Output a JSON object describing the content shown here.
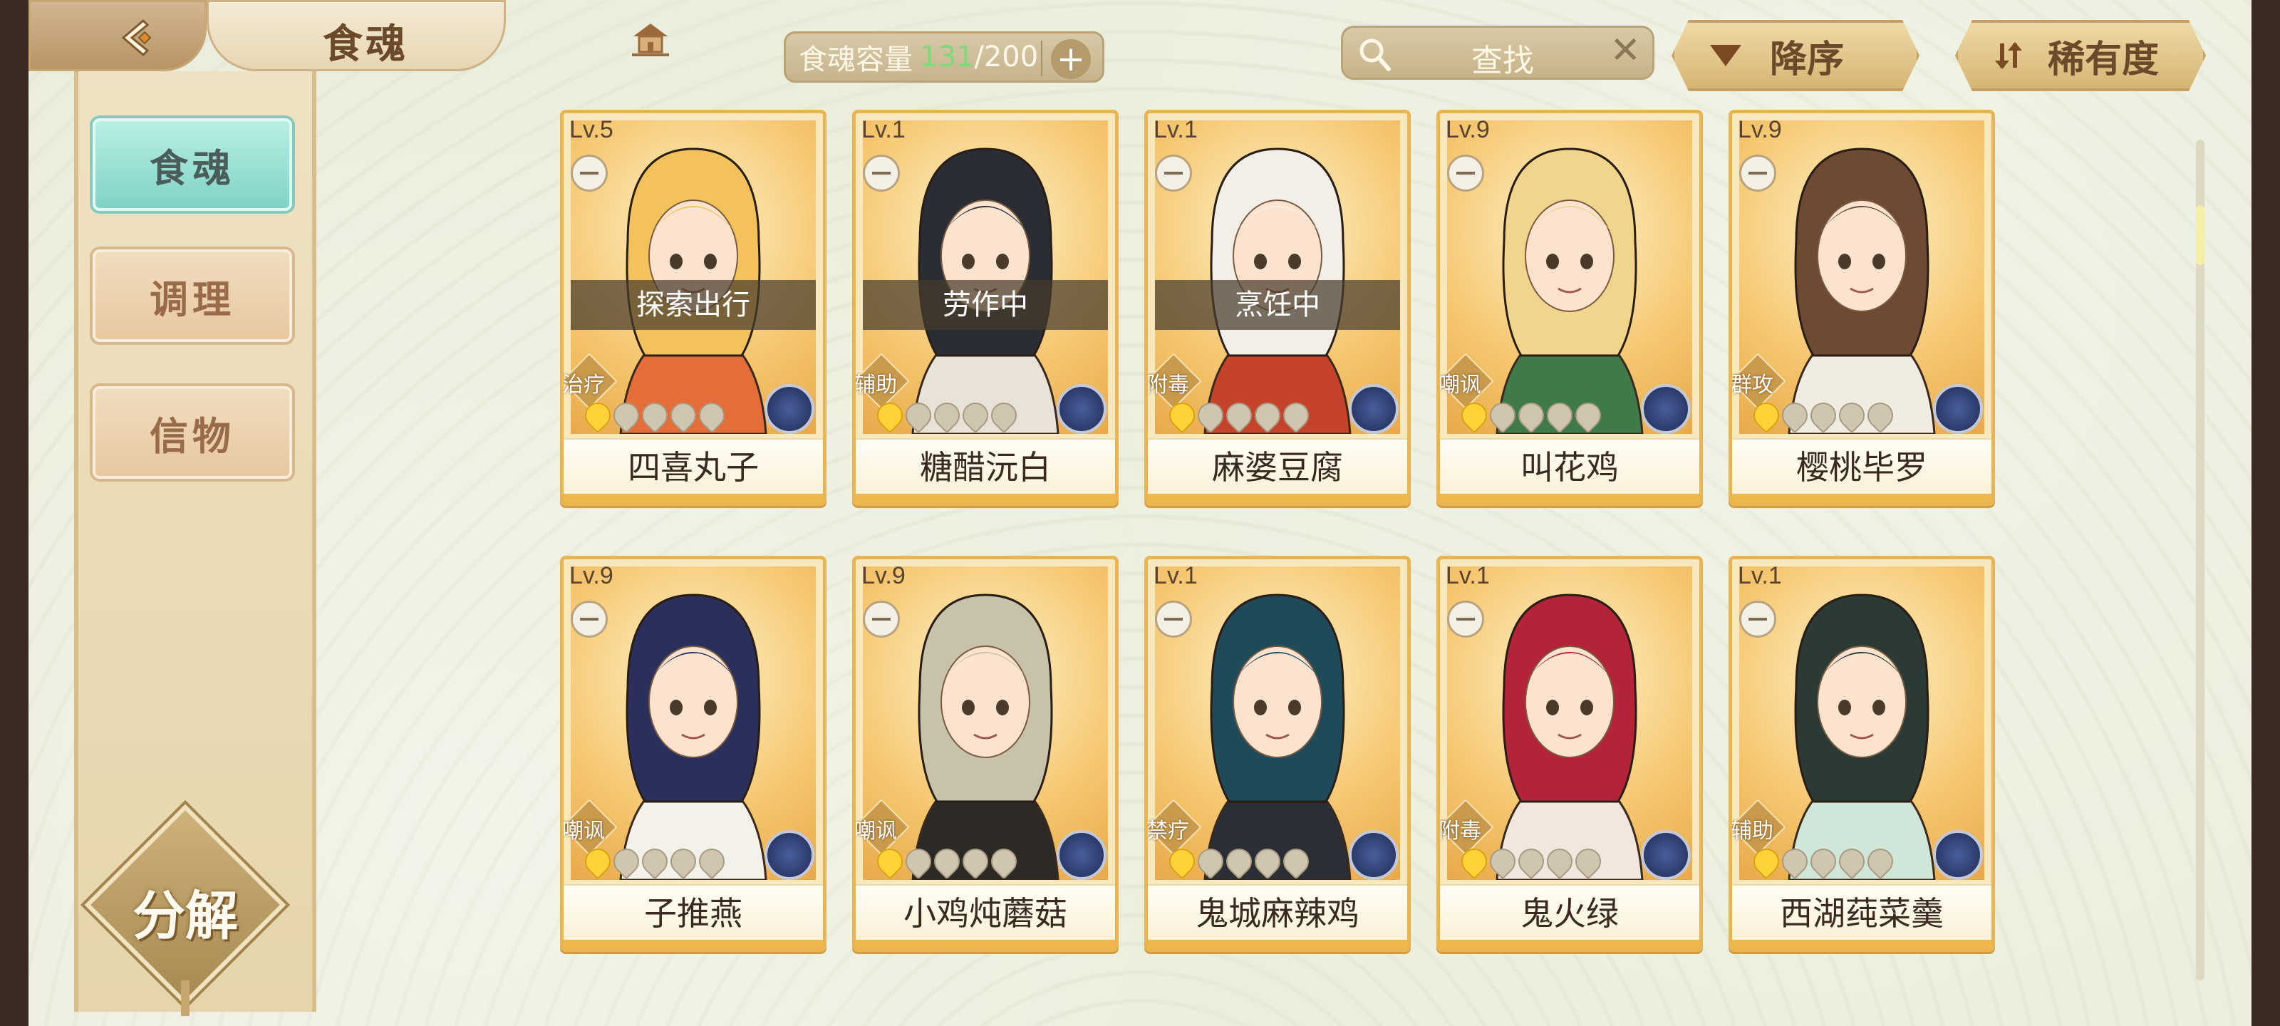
{
  "header": {
    "title": "食魂",
    "capacity_label": "食魂容量",
    "capacity_current": "131",
    "capacity_separator": "/",
    "capacity_max": "200",
    "capacity_add": "+",
    "search_label": "查找",
    "search_clear": "✕",
    "sort_order_label": "降序",
    "sort_field_label": "稀有度"
  },
  "sidebar": {
    "tabs": [
      {
        "label": "食魂",
        "active": true
      },
      {
        "label": "调理",
        "active": false
      },
      {
        "label": "信物",
        "active": false
      }
    ],
    "decompose_label": "分解"
  },
  "cards": [
    {
      "level": "Lv.5",
      "status": "探索出行",
      "role": "治疗",
      "name": "四喜丸子",
      "stars": 1,
      "hair": "#f3c25a",
      "outfit": "#e46d3a"
    },
    {
      "level": "Lv.1",
      "status": "劳作中",
      "role": "辅助",
      "name": "糖醋沅白",
      "stars": 1,
      "hair": "#2b2d35",
      "outfit": "#e8e3d6"
    },
    {
      "level": "Lv.1",
      "status": "烹饪中",
      "role": "附毒",
      "name": "麻婆豆腐",
      "stars": 1,
      "hair": "#f2eee8",
      "outfit": "#c5432a"
    },
    {
      "level": "Lv.9",
      "status": "",
      "role": "嘲讽",
      "name": "叫花鸡",
      "stars": 1,
      "hair": "#f2d58c",
      "outfit": "#3f7a4a"
    },
    {
      "level": "Lv.9",
      "status": "",
      "role": "群攻",
      "name": "樱桃毕罗",
      "stars": 1,
      "hair": "#6e4a35",
      "outfit": "#f1ece2"
    },
    {
      "level": "Lv.9",
      "status": "",
      "role": "嘲讽",
      "name": "子推燕",
      "stars": 1,
      "hair": "#2b2f5c",
      "outfit": "#f4f1ea"
    },
    {
      "level": "Lv.9",
      "status": "",
      "role": "嘲讽",
      "name": "小鸡炖蘑菇",
      "stars": 1,
      "hair": "#c9c2aa",
      "outfit": "#2d2a26"
    },
    {
      "level": "Lv.1",
      "status": "",
      "role": "禁疗",
      "name": "鬼城麻辣鸡",
      "stars": 1,
      "hair": "#1f4a5a",
      "outfit": "#2a2f36"
    },
    {
      "level": "Lv.1",
      "status": "",
      "role": "附毒",
      "name": "鬼火绿",
      "stars": 1,
      "hair": "#b3243a",
      "outfit": "#f2e7df"
    },
    {
      "level": "Lv.1",
      "status": "",
      "role": "辅助",
      "name": "西湖莼菜羹",
      "stars": 1,
      "hair": "#2b3a34",
      "outfit": "#cfe6d9"
    }
  ]
}
